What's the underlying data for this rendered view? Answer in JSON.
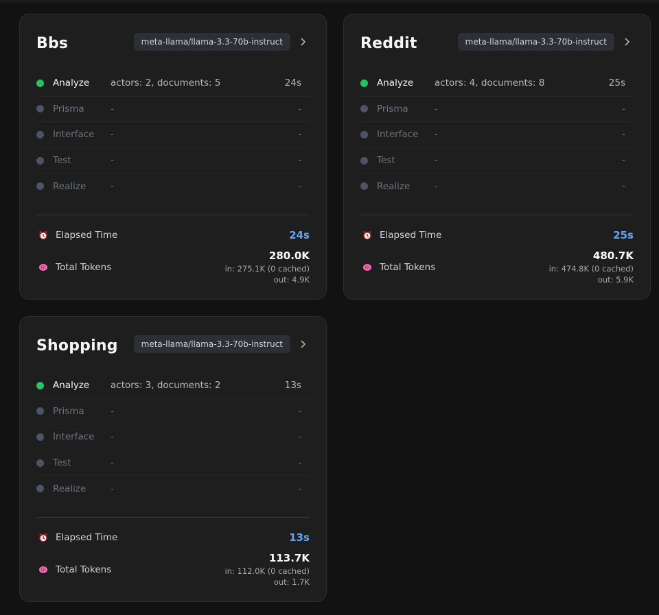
{
  "labels": {
    "elapsed_time": "Elapsed Time",
    "total_tokens": "Total Tokens"
  },
  "colors": {
    "active_dot": "#22c55e",
    "inactive_dot": "#4b5563",
    "elapsed_value": "#60a5fa"
  },
  "icons": {
    "elapsed": "alarm-clock-icon",
    "tokens": "brain-icon",
    "expand": "chevron-right-icon"
  },
  "cards": [
    {
      "title": "Bbs",
      "model": "meta-llama/llama-3.3-70b-instruct",
      "stages": [
        {
          "name": "Analyze",
          "detail": "actors: 2, documents: 5",
          "time": "24s",
          "active": true
        },
        {
          "name": "Prisma",
          "detail": "-",
          "time": "-",
          "active": false
        },
        {
          "name": "Interface",
          "detail": "-",
          "time": "-",
          "active": false
        },
        {
          "name": "Test",
          "detail": "-",
          "time": "-",
          "active": false
        },
        {
          "name": "Realize",
          "detail": "-",
          "time": "-",
          "active": false
        }
      ],
      "elapsed": "24s",
      "tokens_total": "280.0K",
      "tokens_in": "in: 275.1K (0 cached)",
      "tokens_out": "out: 4.9K"
    },
    {
      "title": "Reddit",
      "model": "meta-llama/llama-3.3-70b-instruct",
      "stages": [
        {
          "name": "Analyze",
          "detail": "actors: 4, documents: 8",
          "time": "25s",
          "active": true
        },
        {
          "name": "Prisma",
          "detail": "-",
          "time": "-",
          "active": false
        },
        {
          "name": "Interface",
          "detail": "-",
          "time": "-",
          "active": false
        },
        {
          "name": "Test",
          "detail": "-",
          "time": "-",
          "active": false
        },
        {
          "name": "Realize",
          "detail": "-",
          "time": "-",
          "active": false
        }
      ],
      "elapsed": "25s",
      "tokens_total": "480.7K",
      "tokens_in": "in: 474.8K (0 cached)",
      "tokens_out": "out: 5.9K"
    },
    {
      "title": "Shopping",
      "model": "meta-llama/llama-3.3-70b-instruct",
      "stages": [
        {
          "name": "Analyze",
          "detail": "actors: 3, documents: 2",
          "time": "13s",
          "active": true
        },
        {
          "name": "Prisma",
          "detail": "-",
          "time": "-",
          "active": false
        },
        {
          "name": "Interface",
          "detail": "-",
          "time": "-",
          "active": false
        },
        {
          "name": "Test",
          "detail": "-",
          "time": "-",
          "active": false
        },
        {
          "name": "Realize",
          "detail": "-",
          "time": "-",
          "active": false
        }
      ],
      "elapsed": "13s",
      "tokens_total": "113.7K",
      "tokens_in": "in: 112.0K (0 cached)",
      "tokens_out": "out: 1.7K"
    }
  ]
}
